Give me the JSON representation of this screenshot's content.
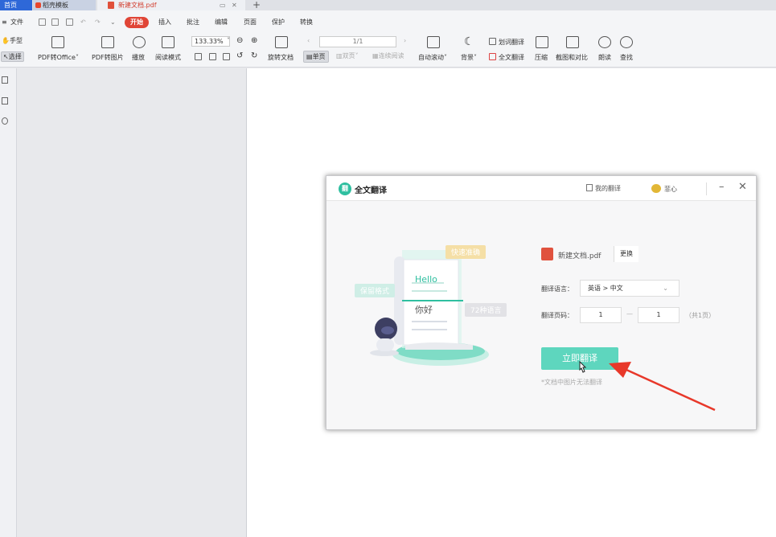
{
  "tabs": {
    "home": "首页",
    "template": "稻壳模板",
    "document": "新建文档.pdf",
    "add": "+"
  },
  "menu": {
    "file": "文件",
    "items": [
      "开始",
      "插入",
      "批注",
      "编辑",
      "页面",
      "保护",
      "转换"
    ],
    "active_index": 0
  },
  "ribbon": {
    "hand": "手型",
    "select": "选择",
    "pdf_to_office": "PDF转Office",
    "pdf_to_image": "PDF转图片",
    "play": "播放",
    "reading_mode": "阅读模式",
    "zoom": "133.33%",
    "page_indicator": "1/1",
    "rotate_doc": "旋转文档",
    "single_page": "单页",
    "double_page": "双页",
    "continuous": "连续阅读",
    "auto_scroll": "自动滚动",
    "background": "背景",
    "word_translate": "划词翻译",
    "full_translate": "全文翻译",
    "compress": "压缩",
    "screenshot_compare": "截图和对比",
    "read_aloud": "朗读",
    "find": "查找"
  },
  "dialog": {
    "logo": "翻",
    "title": "全文翻译",
    "my_translations": "我的翻译",
    "user": "菲心",
    "file_name": "新建文档.pdf",
    "change": "更换",
    "lang_label": "翻译语言：",
    "lang_value": "英语 > 中文",
    "pages_label": "翻译页码：",
    "page_from": "1",
    "page_sep": "—",
    "page_to": "1",
    "total_pages": "（共1页）",
    "translate_button": "立即翻译",
    "note": "*文档中图片无法翻译",
    "illus": {
      "accurate": "快速准确",
      "keep_format": "保留格式",
      "languages": "72种语言",
      "hello": "Hello",
      "nihao": "你好"
    }
  },
  "colors": {
    "accent_red": "#e04536",
    "teal": "#5ed6be",
    "arrow": "#e8382a"
  }
}
